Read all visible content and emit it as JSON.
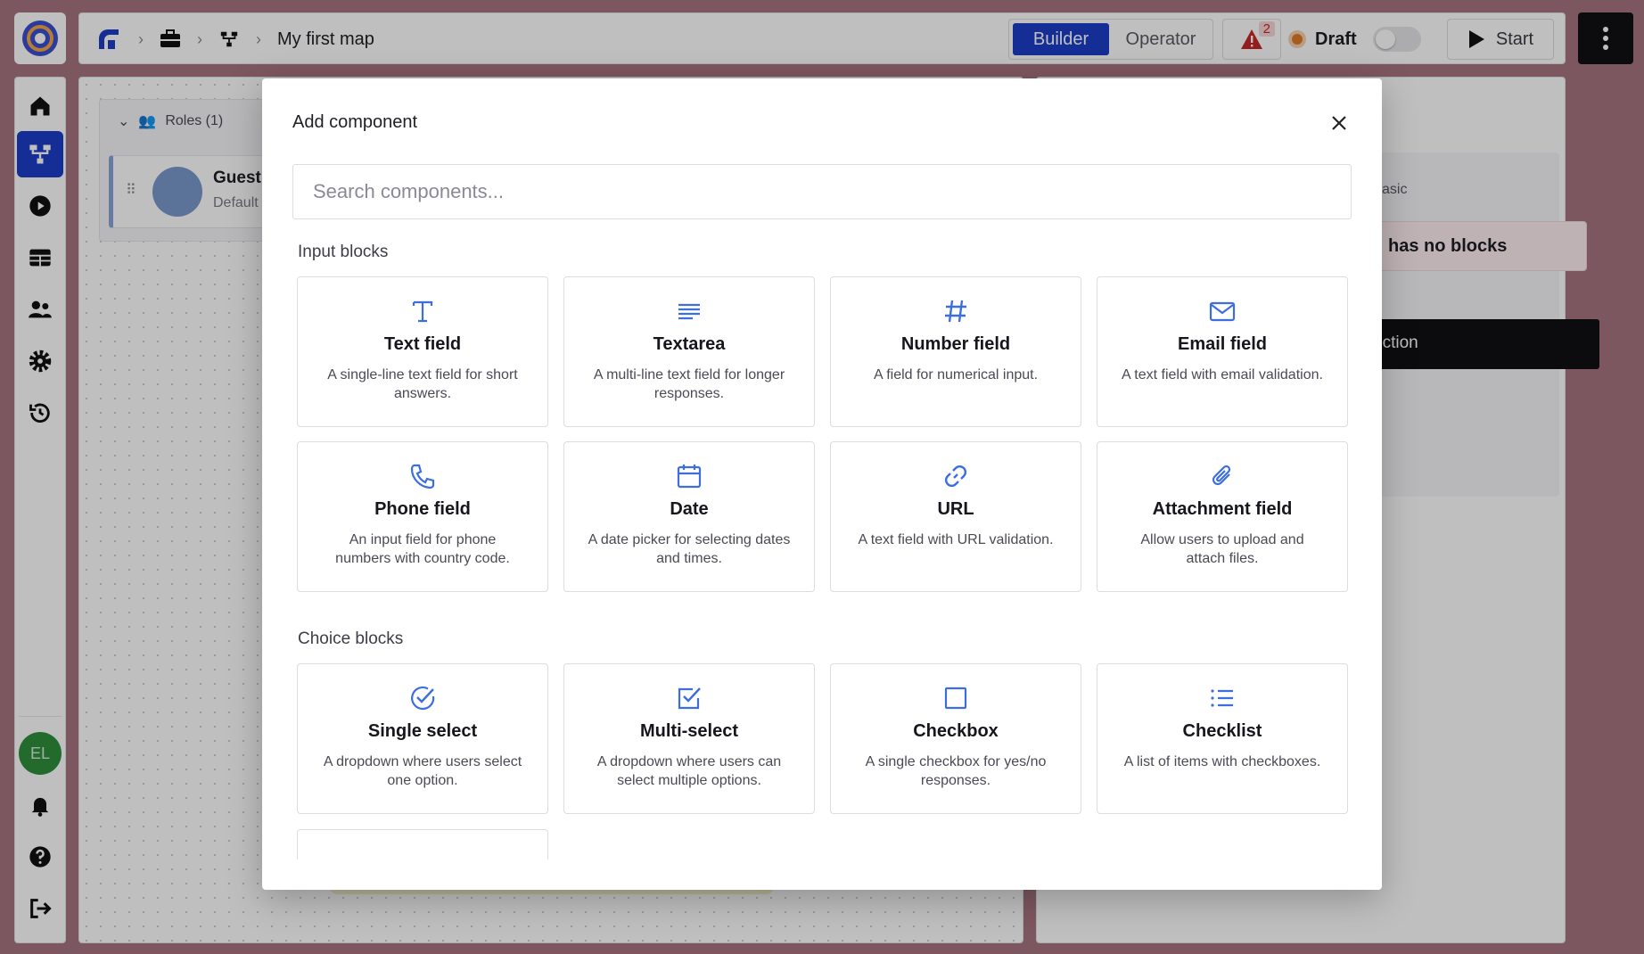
{
  "app": {
    "breadcrumb_title": "My first map",
    "avatar_initials": "EL"
  },
  "topbar": {
    "mode_builder": "Builder",
    "mode_operator": "Operator",
    "alert_count": "2",
    "status_label": "Draft",
    "start_label": "Start"
  },
  "canvas": {
    "roles_header": "Roles (1)",
    "guest_name": "Guest",
    "guest_sub": "Default"
  },
  "right_panel": {
    "basic_label": "asic",
    "no_blocks_label": "has no blocks",
    "section_button_label": "ection"
  },
  "modal": {
    "title": "Add component",
    "search_placeholder": "Search components...",
    "sections": [
      {
        "label": "Input blocks",
        "items": [
          {
            "icon": "text-icon",
            "title": "Text field",
            "desc": "A single-line text field for short answers."
          },
          {
            "icon": "textarea-icon",
            "title": "Textarea",
            "desc": "A multi-line text field for longer responses."
          },
          {
            "icon": "hash-icon",
            "title": "Number field",
            "desc": "A field for numerical input."
          },
          {
            "icon": "mail-icon",
            "title": "Email field",
            "desc": "A text field with email validation."
          },
          {
            "icon": "phone-icon",
            "title": "Phone field",
            "desc": "An input field for phone numbers with country code."
          },
          {
            "icon": "calendar-icon",
            "title": "Date",
            "desc": "A date picker for selecting dates and times."
          },
          {
            "icon": "link-icon",
            "title": "URL",
            "desc": "A text field with URL validation."
          },
          {
            "icon": "paperclip-icon",
            "title": "Attachment field",
            "desc": "Allow users to upload and attach files."
          }
        ]
      },
      {
        "label": "Choice blocks",
        "items": [
          {
            "icon": "circle-check-icon",
            "title": "Single select",
            "desc": "A dropdown where users select one option."
          },
          {
            "icon": "square-check-icon",
            "title": "Multi-select",
            "desc": "A dropdown where users can select multiple options."
          },
          {
            "icon": "square-icon",
            "title": "Checkbox",
            "desc": "A single checkbox for yes/no responses."
          },
          {
            "icon": "list-icon",
            "title": "Checklist",
            "desc": "A list of items with checkboxes."
          }
        ]
      }
    ]
  },
  "colors": {
    "accent": "#1d3ec7",
    "icon_blue": "#3d6ee0",
    "background": "#a77480",
    "draft_dot": "#e07a2a"
  }
}
